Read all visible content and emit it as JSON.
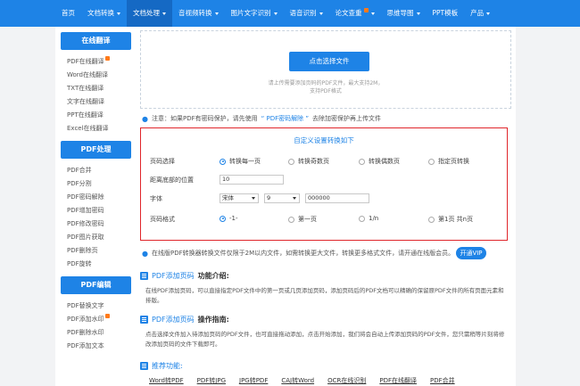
{
  "topnav": {
    "items": [
      {
        "label": "首页",
        "caret": false,
        "hot": false,
        "active": false
      },
      {
        "label": "文档转换",
        "caret": true,
        "hot": false,
        "active": false
      },
      {
        "label": "文档处理",
        "caret": true,
        "hot": false,
        "active": true
      },
      {
        "label": "音视频转换",
        "caret": true,
        "hot": false,
        "active": false
      },
      {
        "label": "图片文字识别",
        "caret": true,
        "hot": false,
        "active": false
      },
      {
        "label": "语音识别",
        "caret": true,
        "hot": false,
        "active": false
      },
      {
        "label": "论文查重",
        "caret": true,
        "hot": true,
        "active": false
      },
      {
        "label": "思维导图",
        "caret": true,
        "hot": false,
        "active": false
      },
      {
        "label": "PPT模板",
        "caret": false,
        "hot": false,
        "active": false
      },
      {
        "label": "产品",
        "caret": true,
        "hot": false,
        "active": false
      }
    ]
  },
  "sidebar": {
    "sections": [
      {
        "title": "在线翻译",
        "items": [
          "PDF在线翻译",
          "Word在线翻译",
          "TXT在线翻译",
          "文字在线翻译",
          "PPT在线翻译",
          "Excel在线翻译"
        ],
        "hot_index": 0
      },
      {
        "title": "PDF处理",
        "items": [
          "PDF合并",
          "PDF分割",
          "PDF密码解除",
          "PDF增加密码",
          "PDF修改密码",
          "PDF图片获取",
          "PDF删除页",
          "PDF旋转"
        ],
        "hot_index": -1
      },
      {
        "title": "PDF编辑",
        "items": [
          "PDF替换文字",
          "PDF添加水印",
          "PDF删除水印",
          "PDF添加文本"
        ],
        "hot_index": 1
      }
    ]
  },
  "upload": {
    "button_label": "点击选择文件",
    "tip_line1": "请上传需要添加页码的PDF文件，最大支持2M，",
    "tip_line2": "支持PDF格式"
  },
  "notice": {
    "prefix": "注意：如果PDF有密码保护，请先使用",
    "link": "“ PDF密码解除 ”",
    "suffix": "去除加密保护再上传文件"
  },
  "settings": {
    "title": "自定义设置转换如下",
    "page_select": {
      "label": "页码选择",
      "options": [
        "转换每一页",
        "转换奇数页",
        "转换偶数页",
        "指定页转换"
      ],
      "selected": 0
    },
    "bottom_distance": {
      "label": "距离底部的位置",
      "value": "10"
    },
    "font": {
      "label": "字体",
      "family": "宋体",
      "size": "9",
      "color": "000000"
    },
    "page_format": {
      "label": "页码格式",
      "options": [
        "-1-",
        "第一页",
        "1/n",
        "第1页 共n页"
      ],
      "selected": 0
    }
  },
  "vip": {
    "text": "在线版PDF转换器转换文件仅限于2M以内文件，如需转换更大文件，转换更多格式文件，请开通在线版会员。",
    "button_label": "开通VIP"
  },
  "intro": {
    "title_highlight": "PDF添加页码",
    "title_rest": "功能介绍:",
    "text": "在线PDF添加页码，可以直接指定PDF文件中的第一页或几页添加页码，添加页码后的PDF文档可以精确的保留原PDF文件的所有页面元素和排版。"
  },
  "guide": {
    "title_highlight": "PDF添加页码",
    "title_rest": "操作指南:",
    "text": "点击选择文件加入待添加页码的PDF文件，也可直接拖动添加，点击开始添加，我们将会自动上传添加页码的PDF文件，您只需稍等片刻将修改添加页码的文件下载即可。"
  },
  "recommend": {
    "title": "推荐功能:",
    "links": [
      "Word转PDF",
      "PDF转JPG",
      "JPG转PDF",
      "CAJ转Word",
      "OCR在线识别",
      "PDF在线翻译",
      "PDF合并"
    ]
  }
}
